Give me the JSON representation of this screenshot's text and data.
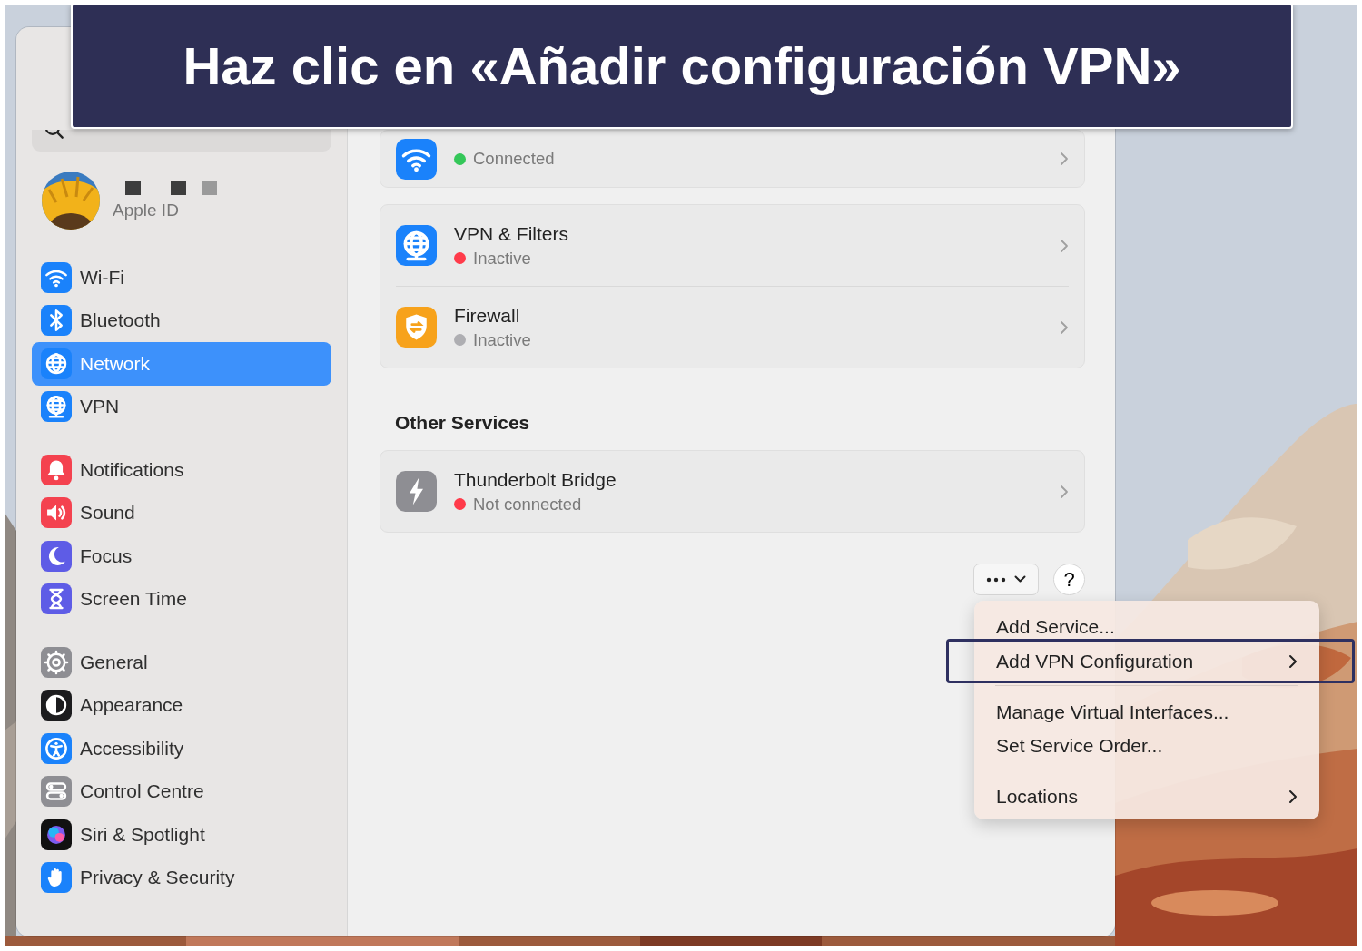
{
  "banner": {
    "text": "Haz clic en «Añadir configuración VPN»"
  },
  "sidebar": {
    "account": {
      "label": "Apple ID"
    },
    "groups": [
      [
        {
          "label": "Wi-Fi",
          "kind": "wifi",
          "selected": false
        },
        {
          "label": "Bluetooth",
          "kind": "bluetooth",
          "selected": false
        },
        {
          "label": "Network",
          "kind": "network",
          "selected": true
        },
        {
          "label": "VPN",
          "kind": "vpn",
          "selected": false
        }
      ],
      [
        {
          "label": "Notifications",
          "kind": "notifications",
          "selected": false
        },
        {
          "label": "Sound",
          "kind": "sound",
          "selected": false
        },
        {
          "label": "Focus",
          "kind": "focus",
          "selected": false
        },
        {
          "label": "Screen Time",
          "kind": "screentime",
          "selected": false
        }
      ],
      [
        {
          "label": "General",
          "kind": "general",
          "selected": false
        },
        {
          "label": "Appearance",
          "kind": "appearance",
          "selected": false
        },
        {
          "label": "Accessibility",
          "kind": "accessibility",
          "selected": false
        },
        {
          "label": "Control Centre",
          "kind": "controlcentre",
          "selected": false
        },
        {
          "label": "Siri & Spotlight",
          "kind": "siri",
          "selected": false
        },
        {
          "label": "Privacy & Security",
          "kind": "privacy",
          "selected": false
        }
      ]
    ]
  },
  "services": [
    {
      "rows": [
        {
          "status": "Connected",
          "color": "#34c759",
          "kind": "wifi"
        }
      ]
    },
    {
      "rows": [
        {
          "title": "VPN & Filters",
          "status": "Inactive",
          "color": "#ff3b4a",
          "kind": "vpn"
        },
        {
          "title": "Firewall",
          "status": "Inactive",
          "color": "#aeaeb2",
          "kind": "firewall"
        }
      ]
    }
  ],
  "other_services": {
    "heading": "Other Services",
    "rows": [
      {
        "title": "Thunderbolt Bridge",
        "status": "Not connected",
        "color": "#ff3b4a",
        "kind": "thunderbolt"
      }
    ]
  },
  "help_button": {
    "label": "?"
  },
  "menu": {
    "items": [
      {
        "kind": "item",
        "label": "Add Service...",
        "submenu": false,
        "callout": false
      },
      {
        "kind": "item",
        "label": "Add VPN Configuration",
        "submenu": true,
        "callout": true
      },
      {
        "kind": "separator"
      },
      {
        "kind": "item",
        "label": "Manage Virtual Interfaces...",
        "submenu": false,
        "callout": false
      },
      {
        "kind": "item",
        "label": "Set Service Order...",
        "submenu": false,
        "callout": false
      },
      {
        "kind": "separator"
      },
      {
        "kind": "item",
        "label": "Locations",
        "submenu": true,
        "callout": false
      }
    ]
  }
}
